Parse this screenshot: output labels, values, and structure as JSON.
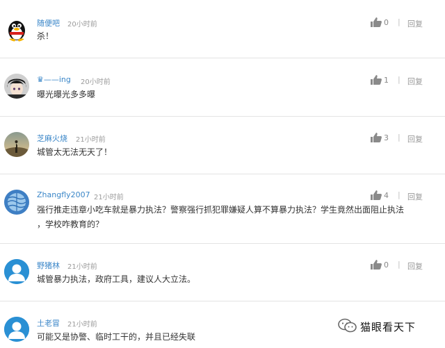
{
  "comments": [
    {
      "username": "随便吧",
      "time": "20小时前",
      "text": "杀！",
      "likes": "0",
      "reply": "回复"
    },
    {
      "username": "♛——ing",
      "time": "20小时前",
      "text": "曝光曝光多多曝",
      "likes": "1",
      "reply": "回复"
    },
    {
      "username": "芝麻火烧",
      "time": "21小时前",
      "text": "城管太无法无天了！",
      "likes": "3",
      "reply": "回复"
    },
    {
      "username": "Zhangfly2007",
      "time": "21小时前",
      "text_line1": "强行推走违章小吃车就是暴力执法？警察强行抓犯罪嫌疑人算不算暴力执法？学生竟然出面阻止执法",
      "text_line2": "，学校咋教育的？",
      "likes": "4",
      "reply": "回复"
    },
    {
      "username": "野猪林",
      "time": "21小时前",
      "text": "城管暴力执法，政府工具，建议人大立法。",
      "likes": "0",
      "reply": "回复"
    },
    {
      "username": "土老冒",
      "time": "21小时前",
      "text": "可能又是协警、临时工干的，并且已经失联"
    }
  ],
  "watermark": {
    "text": "猫眼看天下"
  },
  "colors": {
    "username": "#3a86c8",
    "meta": "#9a9a9a",
    "default_avatar": "#2a90d4"
  },
  "icons": {
    "like": "thumbs-up-icon",
    "watermark": "wechat-icon"
  }
}
